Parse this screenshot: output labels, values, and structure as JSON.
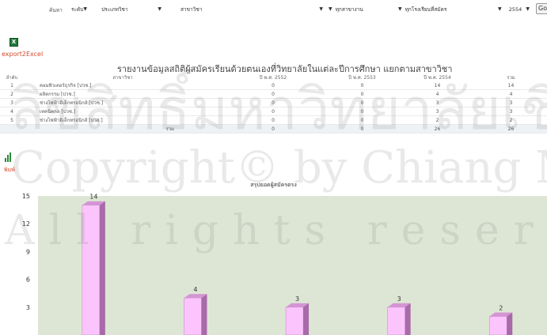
{
  "filters": {
    "region_label": "ค้นหา",
    "level": "ระดับ",
    "category": "ประเภทวิชา",
    "major": "สาขาวิชา",
    "agency": "ทุกสาขางาน",
    "school": "ทุกโรงเรียนที่สมัคร",
    "year": "2554",
    "go_label": "Go"
  },
  "export": {
    "label": "export2Excel",
    "icon": "excel-icon"
  },
  "report": {
    "title": "รายงานข้อมูลสถิติผู้สมัครเรียนด้วยตนเองที่วิทยาลัยในแต่ละปีการศึกษา แยกตามสาขาวิชา",
    "headers": [
      "ลำดับ",
      "สาขาวิชา",
      "ปี พ.ศ. 2552",
      "ปี พ.ศ. 2553",
      "ปี พ.ศ. 2554",
      "รวม"
    ],
    "rows": [
      {
        "no": "1",
        "major": "คอมพิวเตอร์ธุรกิจ [ปวช.]",
        "y2552": "0",
        "y2553": "0",
        "y2554": "14",
        "total": "14"
      },
      {
        "no": "2",
        "major": "ผลิตกรรม [ปวช.]",
        "y2552": "0",
        "y2553": "0",
        "y2554": "4",
        "total": "4"
      },
      {
        "no": "3",
        "major": "ช่างไฟฟ้าอิเล็กทรอนิกส์ [ปวช.]",
        "y2552": "0",
        "y2553": "0",
        "y2554": "3",
        "total": "3"
      },
      {
        "no": "4",
        "major": "เทคนิคกล [ปวช.]",
        "y2552": "0",
        "y2553": "0",
        "y2554": "3",
        "total": "3"
      },
      {
        "no": "5",
        "major": "ช่างไฟฟ้าอิเล็กทรอนิกส์ [ปวส.]",
        "y2552": "0",
        "y2553": "0",
        "y2554": "2",
        "total": "2"
      }
    ],
    "total_row": {
      "label": "รวม",
      "y2552": "0",
      "y2553": "0",
      "y2554": "26",
      "total": "26"
    }
  },
  "print": {
    "label": "พิมพ์",
    "icon": "bar-chart-icon"
  },
  "watermark": {
    "line1": "ลิขสิทธิ์มหาวิทยาลัยเชียงใหม่",
    "line2": "Copyright© by Chiang Mai University",
    "line3": "All rights reserved"
  },
  "colors": {
    "plot_bg": "#dde6d5",
    "bar_front": "#fcc4fc",
    "bar_top": "#d495d4",
    "bar_side": "#a86aa8",
    "accent_red": "#d94a2a"
  },
  "chart_data": {
    "type": "bar",
    "title": "สรุปยอดผู้สมัครตรง",
    "categories": [
      "คอมพิวเตอร์ธุรกิจ [ปวช.]",
      "ผลิตกรรม [ปวช.]",
      "ช่างไฟฟ้าอิเล็กทรอนิกส์ [ปวช.]",
      "เทคนิคกล [ปวช.]",
      "ช่างไฟฟ้าอิเล็กทรอนิกส์ [ปวส.]"
    ],
    "values": [
      14,
      4,
      3,
      3,
      2
    ],
    "yticks": [
      "3",
      "6",
      "9",
      "12",
      "15"
    ],
    "ylim": [
      0,
      15
    ],
    "grid": false,
    "legend": "none"
  }
}
